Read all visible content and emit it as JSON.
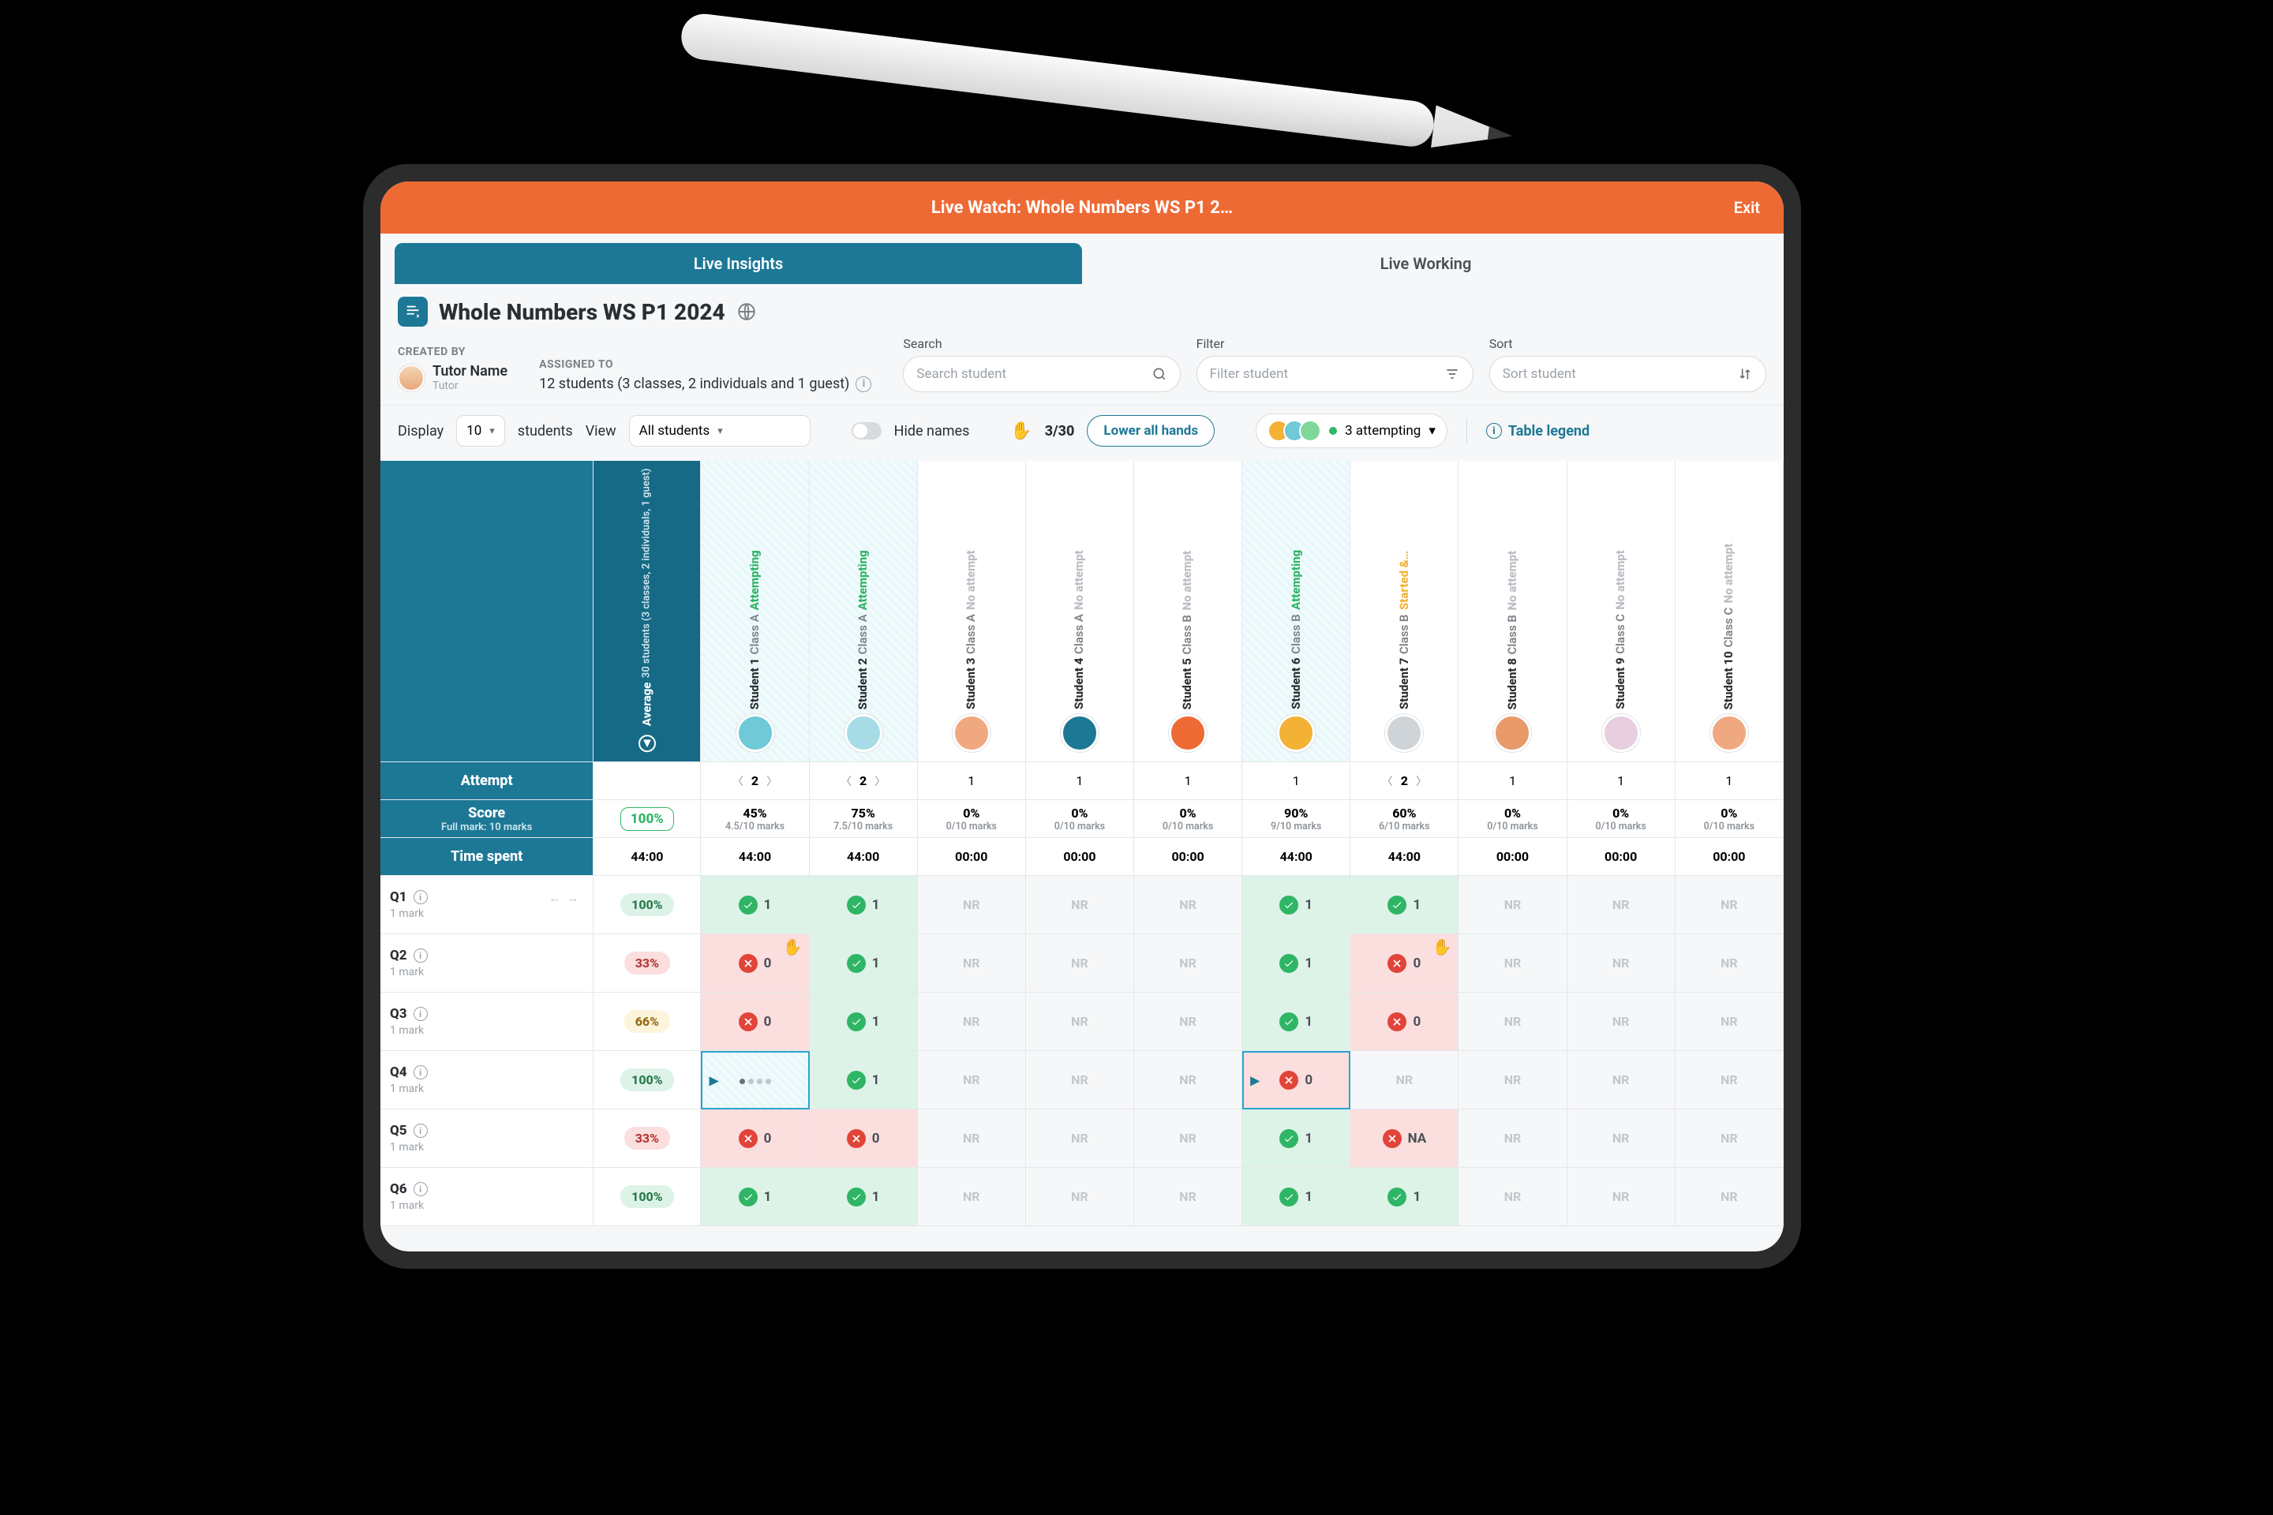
{
  "topbar": {
    "title": "Live Watch: Whole Numbers WS P1 2…",
    "exit": "Exit"
  },
  "tabs": {
    "insights": "Live Insights",
    "working": "Live Working"
  },
  "doc": {
    "title": "Whole Numbers WS P1 2024"
  },
  "meta": {
    "created_label": "CREATED BY",
    "creator_name": "Tutor Name",
    "creator_role": "Tutor",
    "assigned_label": "ASSIGNED TO",
    "assigned_text": "12 students (3 classes, 2 individuals and 1 guest)"
  },
  "search": {
    "label": "Search",
    "placeholder": "Search student"
  },
  "filter": {
    "label": "Filter",
    "placeholder": "Filter student"
  },
  "sort": {
    "label": "Sort",
    "placeholder": "Sort student"
  },
  "controls": {
    "display": "Display",
    "page_size": "10",
    "students_word": "students",
    "view": "View",
    "view_value": "All students",
    "hide_names": "Hide names",
    "hands_ratio": "3/30",
    "lower_all": "Lower all hands",
    "attempting_count": "3 attempting",
    "legend": "Table legend"
  },
  "avg_header": {
    "title": "Average",
    "sub": "30 students (3 classes, 2 individuals, 1 guest)"
  },
  "students": [
    {
      "name": "Student 1",
      "class": "Class A",
      "status": "Attempting",
      "statusClass": "s-att",
      "av": "#6fc9d6",
      "tint": true
    },
    {
      "name": "Student 2",
      "class": "Class A",
      "status": "Attempting",
      "statusClass": "s-att",
      "av": "#a7dce6",
      "tint": true
    },
    {
      "name": "Student 3",
      "class": "Class A",
      "status": "No attempt",
      "statusClass": "s-no",
      "av": "#f0a880"
    },
    {
      "name": "Student 4",
      "class": "Class A",
      "status": "No attempt",
      "statusClass": "s-no",
      "av": "#1d7896"
    },
    {
      "name": "Student 5",
      "class": "Class B",
      "status": "No attempt",
      "statusClass": "s-no",
      "av": "#ee6a34"
    },
    {
      "name": "Student 6",
      "class": "Class B",
      "status": "Attempting",
      "statusClass": "s-att",
      "av": "#f3b236",
      "tint": true
    },
    {
      "name": "Student 7",
      "class": "Class B",
      "status": "Started &…",
      "statusClass": "s-start",
      "av": "#cfd4d8"
    },
    {
      "name": "Student 8",
      "class": "Class B",
      "status": "No attempt",
      "statusClass": "s-no",
      "av": "#e99a6a"
    },
    {
      "name": "Student 9",
      "class": "Class C",
      "status": "No attempt",
      "statusClass": "s-no",
      "av": "#e7cfe0"
    },
    {
      "name": "Student 10",
      "class": "Class C",
      "status": "No attempt",
      "statusClass": "s-no",
      "av": "#f0a880"
    }
  ],
  "rows": {
    "attempt_label": "Attempt",
    "score_label": "Score",
    "score_sub": "Full mark: 10 marks",
    "time_label": "Time spent",
    "avg_score": "100%",
    "avg_time": "44:00",
    "attempts": [
      {
        "type": "nav",
        "n": "2"
      },
      {
        "type": "nav",
        "n": "2"
      },
      {
        "type": "n",
        "n": "1"
      },
      {
        "type": "n",
        "n": "1"
      },
      {
        "type": "n",
        "n": "1"
      },
      {
        "type": "n",
        "n": "1"
      },
      {
        "type": "nav",
        "n": "2"
      },
      {
        "type": "n",
        "n": "1"
      },
      {
        "type": "n",
        "n": "1"
      },
      {
        "type": "n",
        "n": "1"
      }
    ],
    "scores": [
      {
        "p": "45%",
        "m": "4.5/10 marks"
      },
      {
        "p": "75%",
        "m": "7.5/10 marks"
      },
      {
        "p": "0%",
        "m": "0/10 marks"
      },
      {
        "p": "0%",
        "m": "0/10 marks"
      },
      {
        "p": "0%",
        "m": "0/10 marks"
      },
      {
        "p": "90%",
        "m": "9/10 marks"
      },
      {
        "p": "60%",
        "m": "6/10 marks"
      },
      {
        "p": "0%",
        "m": "0/10 marks"
      },
      {
        "p": "0%",
        "m": "0/10 marks"
      },
      {
        "p": "0%",
        "m": "0/10 marks"
      }
    ],
    "times": [
      "44:00",
      "44:00",
      "00:00",
      "00:00",
      "00:00",
      "44:00",
      "44:00",
      "00:00",
      "00:00",
      "00:00"
    ]
  },
  "questions": [
    {
      "q": "Q1",
      "marks": "1 mark",
      "nav": true,
      "avg": "100%",
      "avgClass": "pb-green",
      "cells": [
        {
          "t": "ok",
          "v": "1"
        },
        {
          "t": "ok",
          "v": "1"
        },
        {
          "t": "nr"
        },
        {
          "t": "nr"
        },
        {
          "t": "nr"
        },
        {
          "t": "ok",
          "v": "1"
        },
        {
          "t": "ok",
          "v": "1"
        },
        {
          "t": "nr"
        },
        {
          "t": "nr"
        },
        {
          "t": "nr"
        }
      ]
    },
    {
      "q": "Q2",
      "marks": "1 mark",
      "avg": "33%",
      "avgClass": "pb-red",
      "cells": [
        {
          "t": "x",
          "v": "0",
          "hand": true
        },
        {
          "t": "ok",
          "v": "1"
        },
        {
          "t": "nr"
        },
        {
          "t": "nr"
        },
        {
          "t": "nr"
        },
        {
          "t": "ok",
          "v": "1"
        },
        {
          "t": "x",
          "v": "0",
          "hand": true
        },
        {
          "t": "nr"
        },
        {
          "t": "nr"
        },
        {
          "t": "nr"
        }
      ]
    },
    {
      "q": "Q3",
      "marks": "1 mark",
      "avg": "66%",
      "avgClass": "pb-amber",
      "cells": [
        {
          "t": "x",
          "v": "0"
        },
        {
          "t": "ok",
          "v": "1"
        },
        {
          "t": "nr"
        },
        {
          "t": "nr"
        },
        {
          "t": "nr"
        },
        {
          "t": "ok",
          "v": "1"
        },
        {
          "t": "x",
          "v": "0"
        },
        {
          "t": "nr"
        },
        {
          "t": "nr"
        },
        {
          "t": "nr"
        }
      ]
    },
    {
      "q": "Q4",
      "marks": "1 mark",
      "avg": "100%",
      "avgClass": "pb-green",
      "cells": [
        {
          "t": "dots",
          "hi": true
        },
        {
          "t": "ok",
          "v": "1"
        },
        {
          "t": "nr"
        },
        {
          "t": "nr"
        },
        {
          "t": "nr"
        },
        {
          "t": "x",
          "v": "0",
          "hi": true,
          "play": true
        },
        {
          "t": "nr"
        },
        {
          "t": "nr"
        },
        {
          "t": "nr"
        },
        {
          "t": "nr"
        }
      ]
    },
    {
      "q": "Q5",
      "marks": "1 mark",
      "avg": "33%",
      "avgClass": "pb-red",
      "cells": [
        {
          "t": "x",
          "v": "0"
        },
        {
          "t": "x",
          "v": "0"
        },
        {
          "t": "nr"
        },
        {
          "t": "nr"
        },
        {
          "t": "nr"
        },
        {
          "t": "ok",
          "v": "1"
        },
        {
          "t": "x",
          "v": "NA"
        },
        {
          "t": "nr"
        },
        {
          "t": "nr"
        },
        {
          "t": "nr"
        }
      ]
    },
    {
      "q": "Q6",
      "marks": "1 mark",
      "avg": "100%",
      "avgClass": "pb-green",
      "cells": [
        {
          "t": "ok",
          "v": "1"
        },
        {
          "t": "ok",
          "v": "1"
        },
        {
          "t": "nr"
        },
        {
          "t": "nr"
        },
        {
          "t": "nr"
        },
        {
          "t": "ok",
          "v": "1"
        },
        {
          "t": "ok",
          "v": "1"
        },
        {
          "t": "nr"
        },
        {
          "t": "nr"
        },
        {
          "t": "nr"
        }
      ]
    }
  ],
  "nr_text": "NR"
}
